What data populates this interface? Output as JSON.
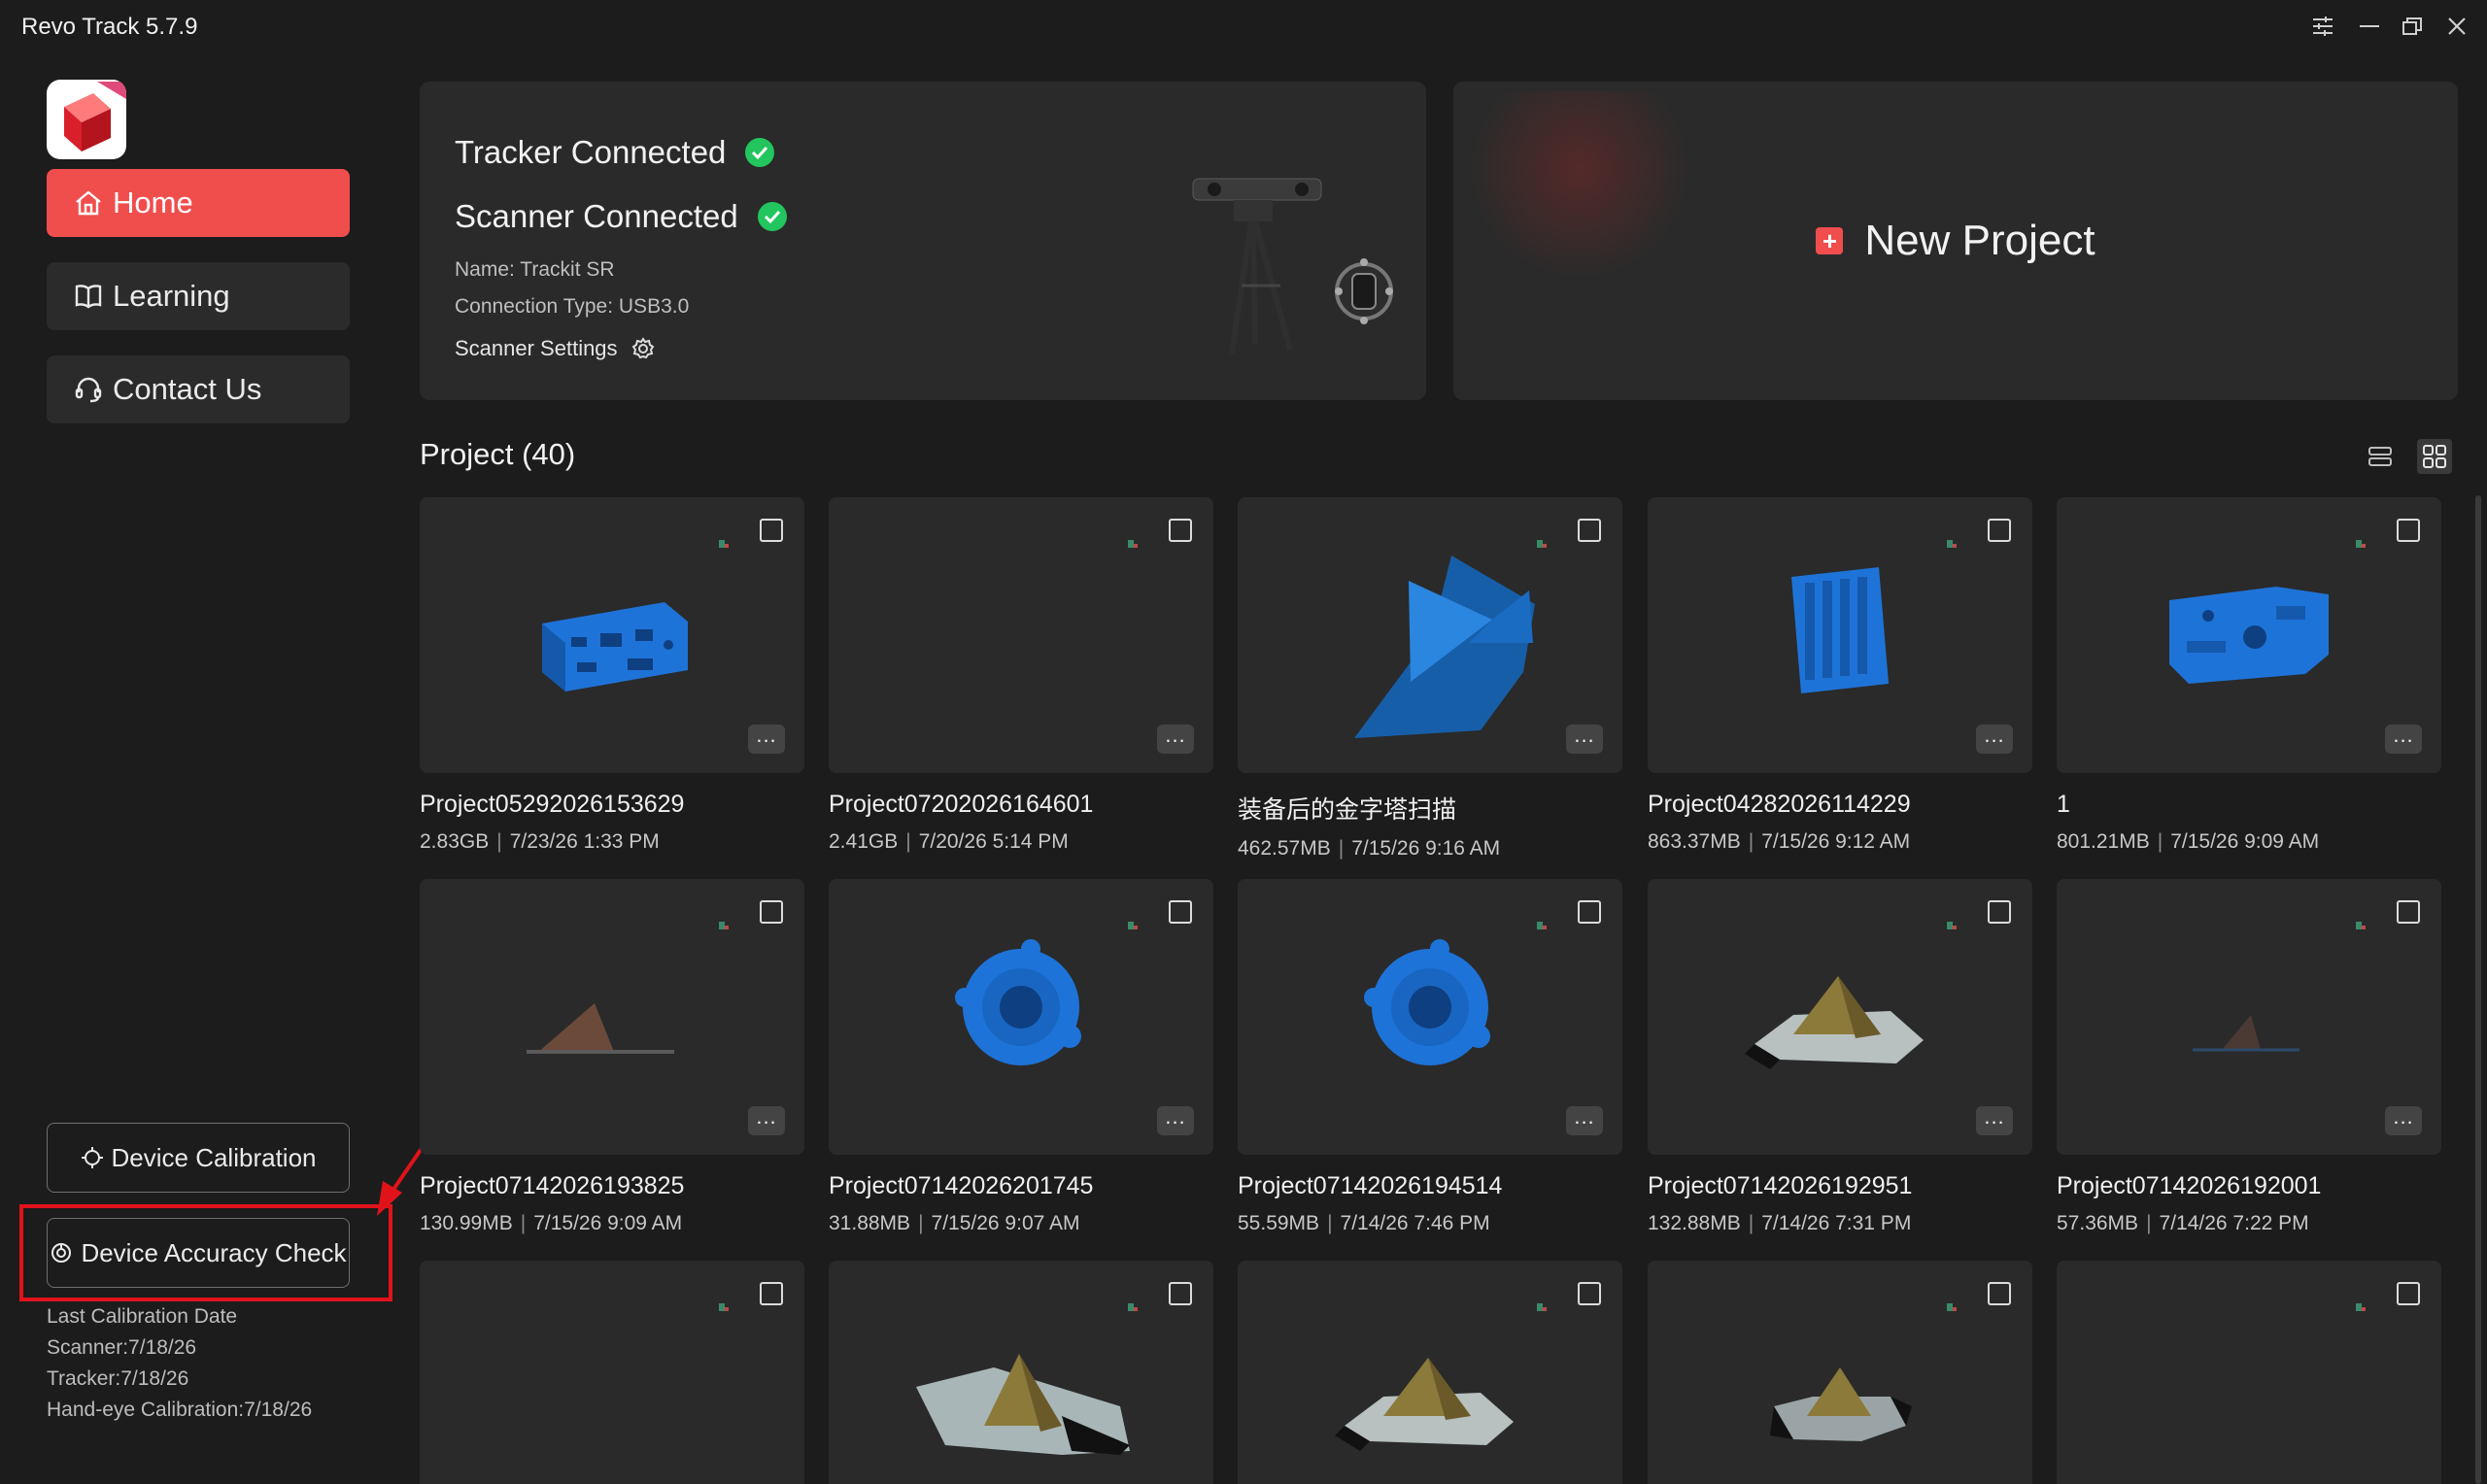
{
  "app": {
    "title": "Revo Track 5.7.9"
  },
  "window_controls": [
    {
      "name": "settings-sliders-icon"
    },
    {
      "name": "minimize-icon"
    },
    {
      "name": "restore-icon"
    },
    {
      "name": "close-icon"
    }
  ],
  "sidebar": {
    "items": [
      {
        "label": "Home",
        "icon": "home-icon",
        "active": true
      },
      {
        "label": "Learning",
        "icon": "book-icon",
        "active": false
      },
      {
        "label": "Contact Us",
        "icon": "headset-icon",
        "active": false
      }
    ],
    "device_calibration_label": "Device Calibration",
    "device_accuracy_label": "Device Accuracy Check",
    "calibration": {
      "heading": "Last Calibration Date",
      "scanner": "Scanner:7/18/26",
      "tracker": "Tracker:7/18/26",
      "hand_eye": "Hand-eye Calibration:7/18/26"
    }
  },
  "status": {
    "tracker": "Tracker Connected",
    "scanner": "Scanner Connected",
    "name": "Name: Trackit SR",
    "connection": "Connection Type: USB3.0",
    "settings_label": "Scanner Settings"
  },
  "new_project": {
    "label": "New Project"
  },
  "projects": {
    "heading": "Project (40)",
    "items": [
      {
        "name": "Project05292026153629",
        "size": "2.83GB",
        "date": "7/23/26 1:33 PM",
        "model": "blue-block"
      },
      {
        "name": "Project07202026164601",
        "size": "2.41GB",
        "date": "7/20/26 5:14 PM",
        "model": "empty"
      },
      {
        "name": "装备后的金字塔扫描",
        "size": "462.57MB",
        "date": "7/15/26 9:16 AM",
        "model": "blue-pyramid"
      },
      {
        "name": "Project04282026114229",
        "size": "863.37MB",
        "date": "7/15/26 9:12 AM",
        "model": "blue-panel"
      },
      {
        "name": "1",
        "size": "801.21MB",
        "date": "7/15/26 9:09 AM",
        "model": "blue-housing"
      },
      {
        "name": "Project07142026193825",
        "size": "130.99MB",
        "date": "7/15/26 9:09 AM",
        "model": "small-pyramid"
      },
      {
        "name": "Project07142026201745",
        "size": "31.88MB",
        "date": "7/15/26 9:07 AM",
        "model": "blue-gear"
      },
      {
        "name": "Project07142026194514",
        "size": "55.59MB",
        "date": "7/14/26 7:46 PM",
        "model": "blue-gear"
      },
      {
        "name": "Project07142026192951",
        "size": "132.88MB",
        "date": "7/14/26 7:31 PM",
        "model": "gold-pyramid"
      },
      {
        "name": "Project07142026192001",
        "size": "57.36MB",
        "date": "7/14/26 7:22 PM",
        "model": "faint-pyramid"
      },
      {
        "name": "",
        "size": "",
        "date": "",
        "model": "empty"
      },
      {
        "name": "",
        "size": "",
        "date": "",
        "model": "gold-pyramid-wide"
      },
      {
        "name": "",
        "size": "",
        "date": "",
        "model": "gold-pyramid"
      },
      {
        "name": "",
        "size": "",
        "date": "",
        "model": "gold-pyramid-dark"
      },
      {
        "name": "",
        "size": "",
        "date": "",
        "model": "empty"
      }
    ]
  },
  "colors": {
    "accent": "#f04d4d",
    "check": "#22c55e",
    "highlight": "#e0131a",
    "model_blue": "#1e73d8"
  }
}
